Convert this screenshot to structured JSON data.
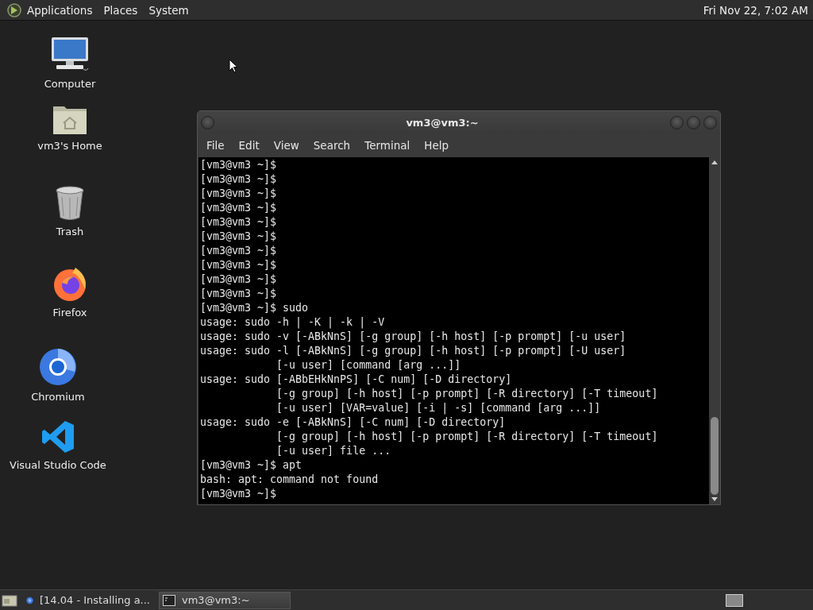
{
  "top_panel": {
    "menus": [
      "Applications",
      "Places",
      "System"
    ],
    "clock": "Fri Nov 22, 7:02 AM"
  },
  "desktop_icons": [
    {
      "kind": "computer",
      "label": "Computer"
    },
    {
      "kind": "home",
      "label": "vm3's Home"
    },
    {
      "kind": "trash",
      "label": "Trash"
    },
    {
      "kind": "firefox",
      "label": "Firefox"
    },
    {
      "kind": "chromium",
      "label": "Chromium"
    },
    {
      "kind": "vscode",
      "label": "Visual Studio Code"
    }
  ],
  "terminal_window": {
    "title": "vm3@vm3:~",
    "menus": [
      "File",
      "Edit",
      "View",
      "Search",
      "Terminal",
      "Help"
    ],
    "lines": [
      "[vm3@vm3 ~]$",
      "[vm3@vm3 ~]$",
      "[vm3@vm3 ~]$",
      "[vm3@vm3 ~]$",
      "[vm3@vm3 ~]$",
      "[vm3@vm3 ~]$",
      "[vm3@vm3 ~]$",
      "[vm3@vm3 ~]$",
      "[vm3@vm3 ~]$",
      "[vm3@vm3 ~]$",
      "[vm3@vm3 ~]$ sudo",
      "usage: sudo -h | -K | -k | -V",
      "usage: sudo -v [-ABkNnS] [-g group] [-h host] [-p prompt] [-u user]",
      "usage: sudo -l [-ABkNnS] [-g group] [-h host] [-p prompt] [-U user]",
      "            [-u user] [command [arg ...]]",
      "usage: sudo [-ABbEHkNnPS] [-C num] [-D directory]",
      "            [-g group] [-h host] [-p prompt] [-R directory] [-T timeout]",
      "            [-u user] [VAR=value] [-i | -s] [command [arg ...]]",
      "usage: sudo -e [-ABkNnS] [-C num] [-D directory]",
      "            [-g group] [-h host] [-p prompt] [-R directory] [-T timeout]",
      "            [-u user] file ...",
      "[vm3@vm3 ~]$ apt",
      "bash: apt: command not found",
      "[vm3@vm3 ~]$"
    ]
  },
  "taskbar": {
    "items": [
      {
        "kind": "browser",
        "label": "[14.04 - Installing a...",
        "selected": false
      },
      {
        "kind": "terminal",
        "label": "vm3@vm3:~",
        "selected": true
      }
    ]
  }
}
